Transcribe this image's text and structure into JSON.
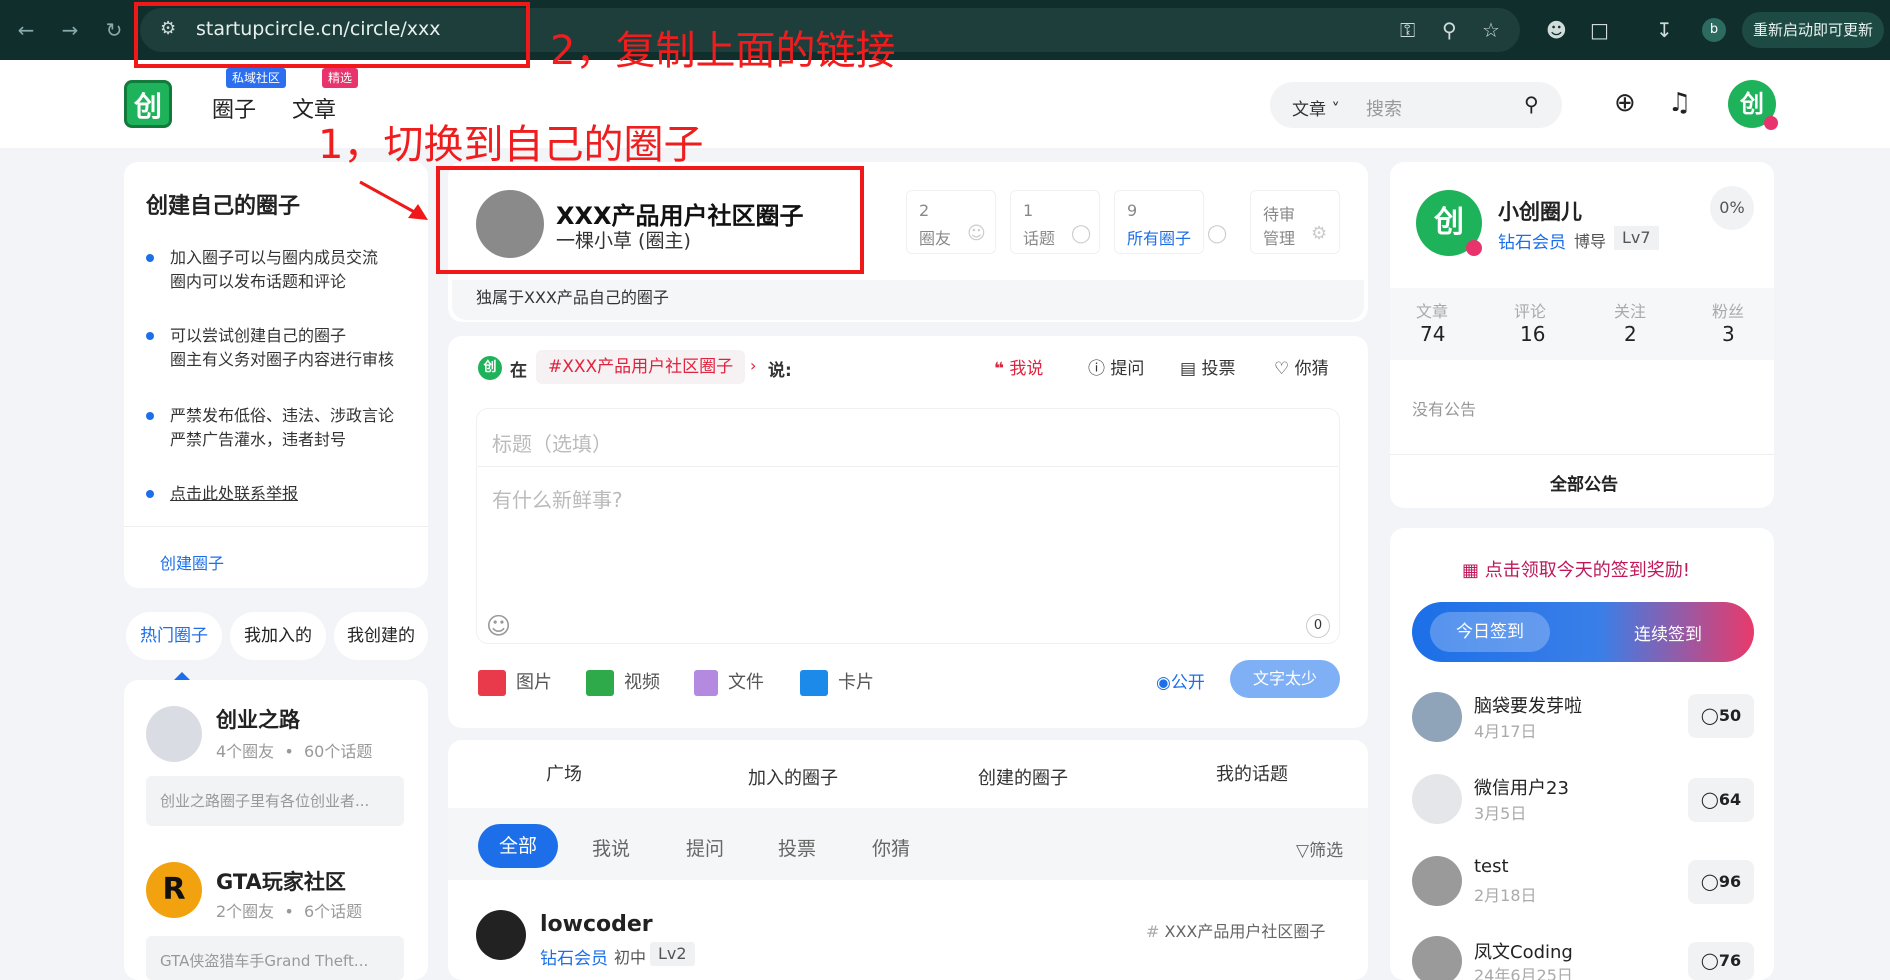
{
  "browser": {
    "url": "startupcircle.cn/circle/xxx",
    "restart_label": "重新启动即可更新",
    "profile_letter": "b"
  },
  "annotations": {
    "step2": "2，复制上面的链接",
    "step1": "1，切换到自己的圈子"
  },
  "header": {
    "logo": "创",
    "nav": [
      {
        "label": "圈子",
        "tag": "私域社区",
        "tag_color": "#2c6ef0"
      },
      {
        "label": "文章",
        "tag": "精选",
        "tag_color": "#e8336d"
      }
    ],
    "search": {
      "category": "文章",
      "placeholder": "搜索"
    },
    "avatar": "创"
  },
  "left": {
    "title": "创建自己的圈子",
    "rules": [
      [
        "加入圈子可以与圈内成员交流",
        "圈内可以发布话题和评论"
      ],
      [
        "可以尝试创建自己的圈子",
        "圈主有义务对圈子内容进行审核"
      ],
      [
        "严禁发布低俗、违法、涉政言论",
        "严禁广告灌水，违者封号"
      ]
    ],
    "report_link": "点击此处联系举报",
    "create_link": "创建圈子",
    "tabs": [
      "热门圈子",
      "我加入的",
      "我创建的"
    ],
    "circles": [
      {
        "name": "创业之路",
        "members": "4个圈友",
        "topics": "60个话题",
        "desc": "创业之路圈子里有各位创业者..."
      },
      {
        "name": "GTA玩家社区",
        "members": "2个圈友",
        "topics": "6个话题",
        "desc": "GTA侠盗猎车手Grand Theft..."
      }
    ]
  },
  "circle": {
    "name": "XXX产品用户社区圈子",
    "owner": "一棵小草 (圈主)",
    "description": "独属于XXX产品自己的圈子",
    "stats": [
      {
        "num": "2",
        "label": "圈友"
      },
      {
        "num": "1",
        "label": "话题"
      },
      {
        "num": "9",
        "label": "所有圈子"
      },
      {
        "num": "待审",
        "label": "管理"
      }
    ]
  },
  "composer": {
    "in_label": "在",
    "circle_tag": "#XXX产品用户社区圈子",
    "say_label": "说:",
    "types": [
      "我说",
      "提问",
      "投票",
      "你猜"
    ],
    "title_placeholder": "标题（选填）",
    "body_placeholder": "有什么新鲜事?",
    "char_count": "0",
    "attachments": [
      "图片",
      "视频",
      "文件",
      "卡片"
    ],
    "visibility": "公开",
    "submit": "文字太少"
  },
  "feed": {
    "tabs": [
      "广场",
      "加入的圈子",
      "创建的圈子",
      "我的话题"
    ],
    "sub_tabs": [
      "全部",
      "我说",
      "提问",
      "投票",
      "你猜"
    ],
    "filter": "筛选",
    "post": {
      "author": "lowcoder",
      "vip": "钻石会员",
      "role": "初中",
      "level": "Lv2",
      "circle": "XXX产品用户社区圈子"
    }
  },
  "profile": {
    "name": "小创圈儿",
    "vip": "钻石会员",
    "role": "博导",
    "level": "Lv7",
    "progress": "0%",
    "stats": [
      {
        "label": "文章",
        "value": "74"
      },
      {
        "label": "评论",
        "value": "16"
      },
      {
        "label": "关注",
        "value": "2"
      },
      {
        "label": "粉丝",
        "value": "3"
      }
    ],
    "notice": "没有公告",
    "all_notice": "全部公告"
  },
  "checkin": {
    "tip": "点击领取今天的签到奖励!",
    "today": "今日签到",
    "continuous": "连续签到",
    "ranks": [
      {
        "name": "脑袋要发芽啦",
        "date": "4月17日",
        "points": "50"
      },
      {
        "name": "微信用户23",
        "date": "3月5日",
        "points": "64"
      },
      {
        "name": "test",
        "date": "2月18日",
        "points": "96"
      },
      {
        "name": "凤文Coding",
        "date": "24年6月25日",
        "points": "76"
      }
    ]
  }
}
